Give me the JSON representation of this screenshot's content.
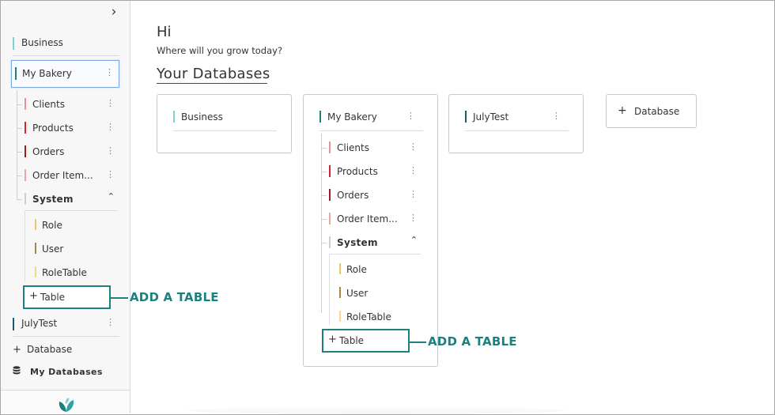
{
  "sidebar": {
    "databases": [
      {
        "label": "Business",
        "color": "#7fd3d3"
      },
      {
        "label": "My Bakery",
        "color": "#1e7f7f"
      },
      {
        "label": "JulyTest",
        "color": "#1e5a6e"
      }
    ],
    "tables": [
      {
        "label": "Clients",
        "color": "#e3939a"
      },
      {
        "label": "Products",
        "color": "#d0272f"
      },
      {
        "label": "Orders",
        "color": "#9d1b22"
      },
      {
        "label": "Order Item...",
        "color": "#e8a7a7"
      }
    ],
    "system": {
      "label": "System",
      "color": "#c9cdd4"
    },
    "system_tables": [
      {
        "label": "Role",
        "color": "#f0c46a"
      },
      {
        "label": "User",
        "color": "#a88442"
      },
      {
        "label": "RoleTable",
        "color": "#f5d98a"
      }
    ],
    "add_table_label": "Table",
    "add_database_label": "Database",
    "my_databases_label": "My Databases"
  },
  "callout": {
    "add_table": "ADD A TABLE"
  },
  "main": {
    "greeting": "Hi",
    "subtitle": "Where will you grow today?",
    "section_title": "Your Databases",
    "cards": [
      {
        "label": "Business",
        "color": "#7fd3d3"
      },
      {
        "label": "My Bakery",
        "color": "#1e7f7f"
      },
      {
        "label": "JulyTest",
        "color": "#1e5a6e"
      }
    ],
    "add_database_label": "Database"
  },
  "colors": {
    "accent": "#1e7f7f",
    "selected_border": "#7aa7e0"
  }
}
